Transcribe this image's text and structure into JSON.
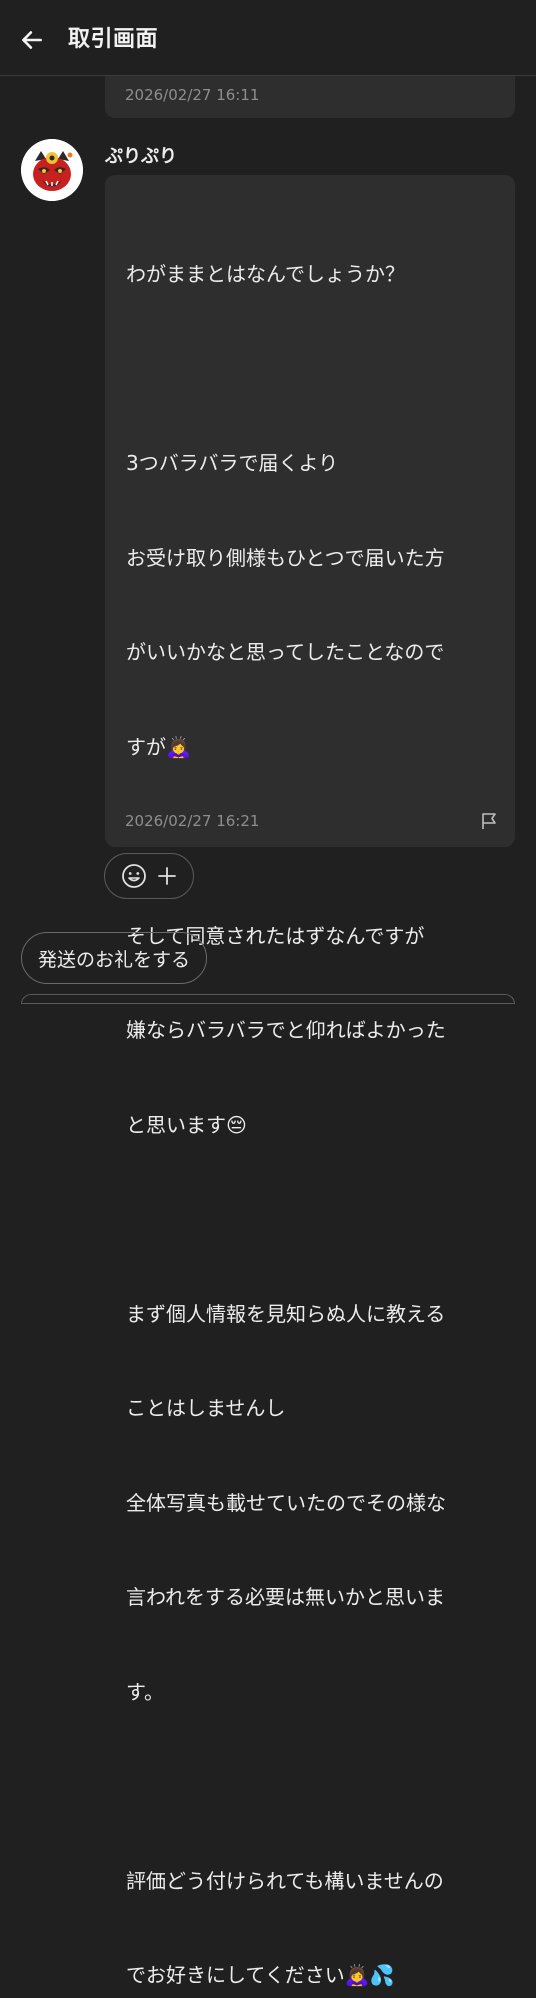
{
  "header": {
    "title": "取引画面"
  },
  "previous_message": {
    "time": "2026/02/27 16:11"
  },
  "message": {
    "sender": "ぷりぷり",
    "lines": [
      "わがままとはなんでしょうか？",
      "",
      "3つバラバラで届くより",
      "お受け取り側様もひとつで届いた方",
      "がいいかなと思ってしたことなので",
      "すが🙇‍♀️",
      "",
      "そして同意されたはずなんですが",
      "嫌ならバラバラでと仰ればよかった",
      "と思います😔",
      "",
      "まず個人情報を見知らぬ人に教える",
      "ことはしませんし",
      "全体写真も載せていたのでその様な",
      "言われをする必要は無いかと思いま",
      "す。",
      "",
      "評価どう付けられても構いませんの",
      "でお好きにしてください🙇‍♀️💦"
    ],
    "time": "2026/02/27 16:21"
  },
  "actions": {
    "thanks_label": "発送のお礼をする"
  },
  "icons": {
    "back": "arrow-left-icon",
    "flag": "flag-icon",
    "emoji": "smiley-icon",
    "add": "plus-icon"
  },
  "colors": {
    "background": "#202020",
    "bubble": "#2e2e2e",
    "text": "#ececec",
    "muted": "#8e8e8e"
  }
}
